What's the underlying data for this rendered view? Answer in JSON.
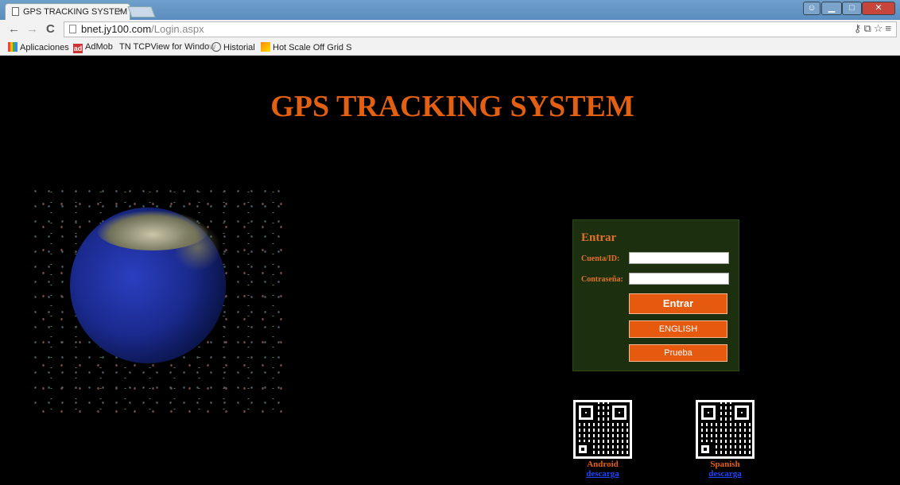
{
  "browser": {
    "tab_title": "GPS TRACKING SYSTEM",
    "tab_close": "×",
    "url_host": "bnet.jy100.com",
    "url_path": "/Login.aspx",
    "bookmarks": [
      "Aplicaciones",
      "AdMob",
      "TN TCPView for Windo",
      "Historial",
      "Hot Scale Off Grid S"
    ],
    "bookmark_fade": [
      "w",
      "S"
    ],
    "admob_icon_text": "ad"
  },
  "page": {
    "title": "GPS TRACKING SYSTEM",
    "title_color": "#e35f12"
  },
  "login": {
    "heading": "Entrar",
    "user_label": "Cuenta/ID:",
    "user_value": "",
    "pass_label": "Contraseña:",
    "pass_value": "",
    "login_button": "Entrar",
    "english_button": "ENGLISH",
    "trial_button": "Prueba",
    "button_color": "#e55a0f",
    "panel_color": "#1c3010"
  },
  "downloads": [
    {
      "name": "Android",
      "link": "descarga"
    },
    {
      "name": "Spanish",
      "link": "descarga"
    }
  ]
}
